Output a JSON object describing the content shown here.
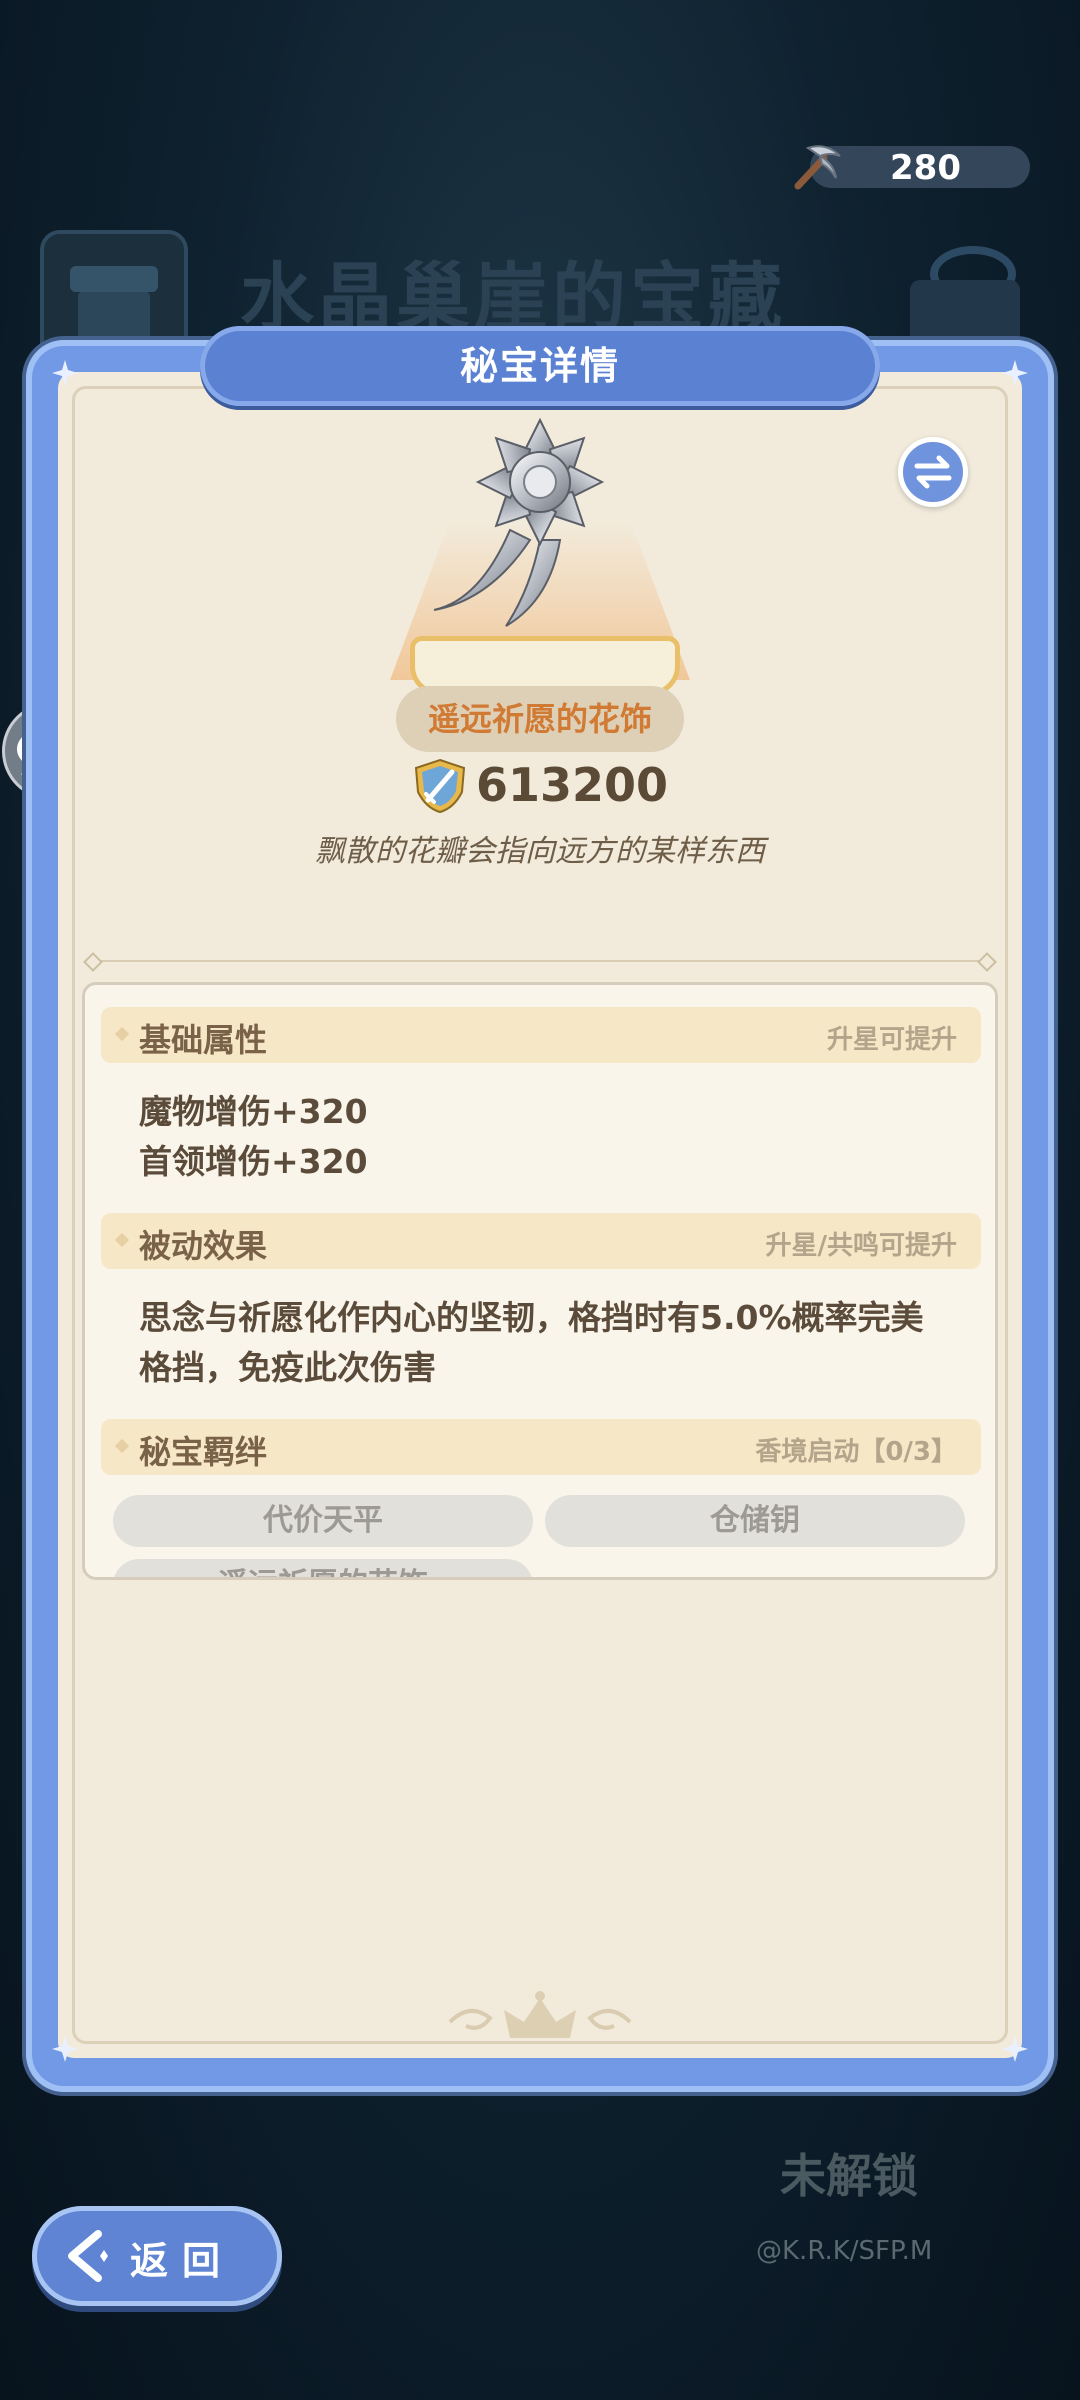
{
  "background": {
    "event_title": "水晶巢崖的宝藏",
    "locked_label": "未解锁",
    "credit": "@K.R.K/SFP.M"
  },
  "currency": {
    "icon": "pickaxe-icon",
    "amount": "280"
  },
  "panel": {
    "title": "秘宝详情",
    "item_name": "遥远祈愿的花饰",
    "power": "613200",
    "flavor_text": "飘散的花瓣会指向远方的某样东西"
  },
  "sections": {
    "base": {
      "label": "基础属性",
      "hint": "升星可提升",
      "lines": [
        "魔物增伤+320",
        "首领增伤+320"
      ]
    },
    "passive": {
      "label": "被动效果",
      "hint": "升星/共鸣可提升",
      "lines": [
        "思念与祈愿化作内心的坚韧，格挡时有5.0%概率完美",
        "格挡，免疫此次伤害"
      ]
    },
    "bond": {
      "label": "秘宝羁绊",
      "hint": "香境启动【0/3】",
      "items": [
        "代价天平",
        "仓储钥",
        "遥远祈愿的花饰"
      ]
    }
  },
  "back_button": {
    "label": "返回"
  },
  "colors": {
    "frame_blue": "#7199e5",
    "parchment": "#f2ebdc",
    "name_orange": "#d17a33"
  }
}
